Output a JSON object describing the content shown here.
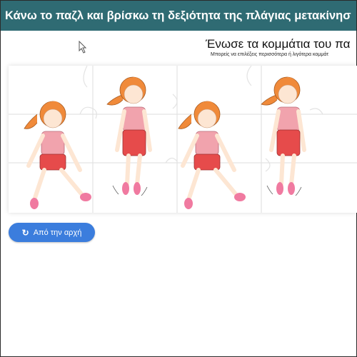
{
  "header": {
    "title": "Κάνω το παζλ και βρίσκω τη δεξιότητα της πλάγιας μετακίνησ"
  },
  "puzzle": {
    "title": "Ένωσε τα κομμάτια του πα",
    "subtitle": "Μπορείς να επιλέξεις περισσότερα ή λιγότερα κομμάτ"
  },
  "actions": {
    "reset_label": "Από την αρχή",
    "reset_icon": "refresh-icon"
  },
  "colors": {
    "header_bg": "#2f6b73",
    "button_bg": "#3b7ddd",
    "shirt": "#f1a3ad",
    "shorts": "#e64b4b",
    "hair": "#f08a3a",
    "shoes": "#f07aa0"
  }
}
